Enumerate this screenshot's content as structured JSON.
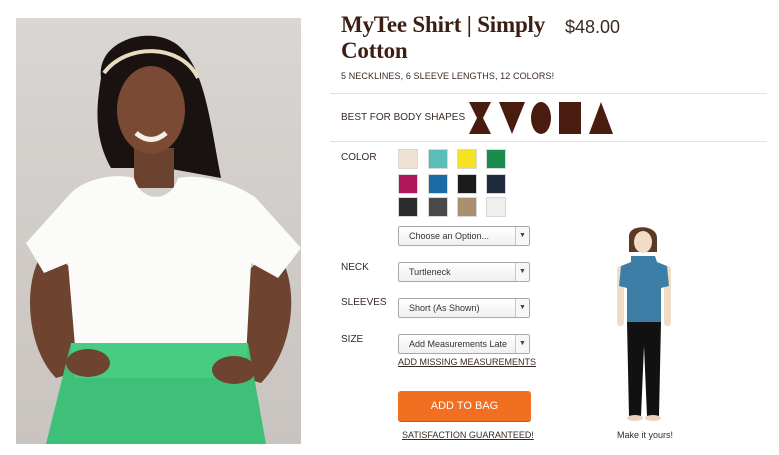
{
  "product": {
    "title": "MyTee Shirt | Simply Cotton",
    "price": "$48.00",
    "tagline": "5 NECKLINES, 6 SLEEVE LENGTHS, 12 COLORS!"
  },
  "body_shapes": {
    "label": "BEST FOR BODY SHAPES",
    "shapes": [
      "hourglass-shape-icon",
      "v-shape-icon",
      "oval-shape-icon",
      "rectangle-shape-icon",
      "triangle-shape-icon"
    ],
    "color": "#4a1c10"
  },
  "color": {
    "label": "COLOR",
    "swatches": [
      "#eee3d3",
      "#5bbcb8",
      "#f5e323",
      "#1a8d4e",
      "#b0165a",
      "#1a6aa8",
      "#1b1b1b",
      "#1e2a3c",
      "#2c2c2c",
      "#4a4a4a",
      "#a89070",
      "#efefef"
    ],
    "select_value": "Choose an Option..."
  },
  "neck": {
    "label": "NECK",
    "value": "Turtleneck"
  },
  "sleeves": {
    "label": "SLEEVES",
    "value": "Short (As Shown)"
  },
  "size": {
    "label": "SIZE",
    "value": "Add Measurements Late",
    "missing_link": "ADD MISSING MEASUREMENTS"
  },
  "cta": {
    "add_to_bag": "ADD TO BAG",
    "satisfaction": "SATISFACTION GUARANTEED!",
    "accent": "#f26f21"
  },
  "preview": {
    "caption": "Make it yours!",
    "top_color": "#3d7ea6",
    "pants_color": "#111111"
  }
}
